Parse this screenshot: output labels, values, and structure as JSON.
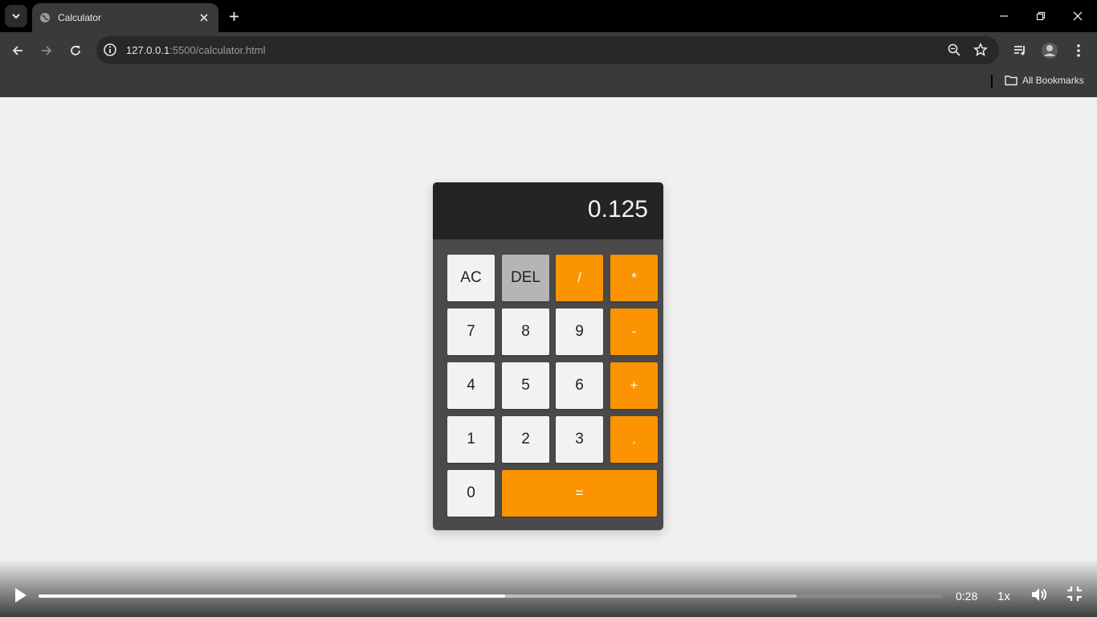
{
  "browser": {
    "tab_title": "Calculator",
    "url_host": "127.0.0.1",
    "url_path": ":5500/calculator.html",
    "bookmarks_label": "All Bookmarks"
  },
  "calculator": {
    "display": "0.125",
    "keys": {
      "ac": "AC",
      "del": "DEL",
      "divide": "/",
      "multiply": "*",
      "seven": "7",
      "eight": "8",
      "nine": "9",
      "minus": "-",
      "four": "4",
      "five": "5",
      "six": "6",
      "plus": "+",
      "one": "1",
      "two": "2",
      "three": "3",
      "decimal": ".",
      "zero": "0",
      "equals": "="
    },
    "colors": {
      "operator": "#fb9400",
      "delete": "#b5b5b5",
      "digit": "#f2f2f2",
      "display_bg": "#242424",
      "body_bg": "#4a4a4a"
    }
  },
  "video": {
    "time": "0:28",
    "speed": "1x",
    "progress_fraction": 0.516,
    "buffered_fraction": 0.838
  }
}
